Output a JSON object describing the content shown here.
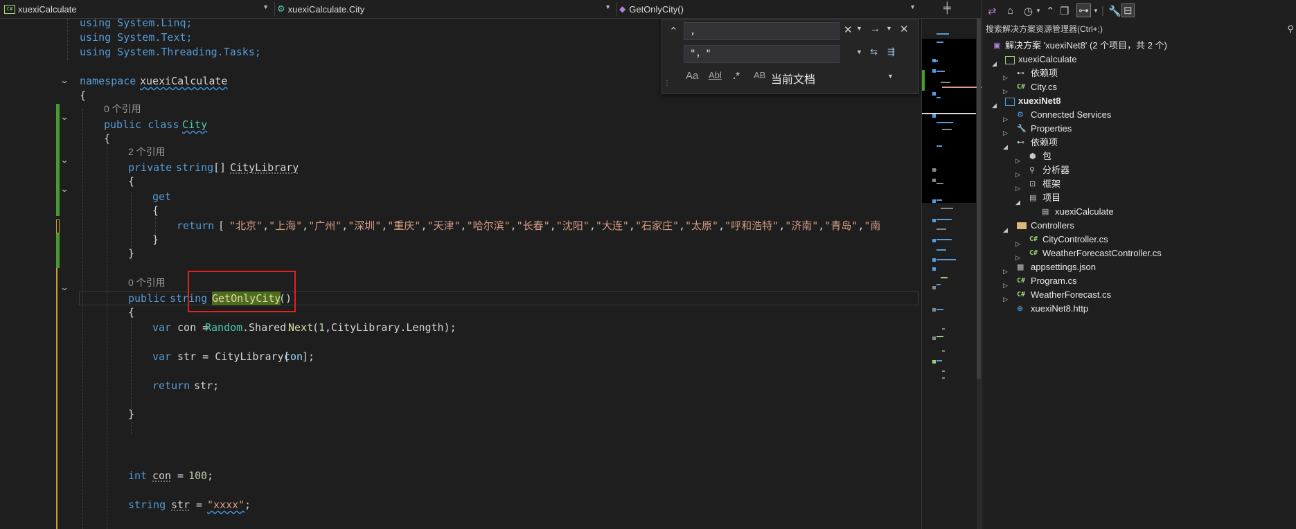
{
  "navbar": {
    "project": "xuexiCalculate",
    "class": "xuexiCalculate.City",
    "member": "GetOnlyCity()"
  },
  "code": {
    "using_linq": "using System.Linq;",
    "using_text": "using System.Text;",
    "using_tasks": "using System.Threading.Tasks;",
    "ns_kw": "namespace",
    "ns_name": "xuexiCalculate",
    "brace_open": "{",
    "brace_close": "}",
    "refs0": "0 个引用",
    "refs2": "2 个引用",
    "class_mods": "public class",
    "class_name": "City",
    "prop_mods": "private",
    "prop_type": "string",
    "prop_arr": "[]",
    "prop_name": "CityLibrary",
    "get_kw": "get",
    "return_kw": "return",
    "return_open": " [",
    "cities": [
      "\"北京\"",
      "\"上海\"",
      "\"广州\"",
      "\"深圳\"",
      "\"重庆\"",
      "\"天津\"",
      "\"哈尔滨\"",
      "\"长春\"",
      "\"沈阳\"",
      "\"大连\"",
      "\"石家庄\"",
      "\"太原\"",
      "\"呼和浩特\"",
      "\"济南\"",
      "\"青岛\"",
      "\"南"
    ],
    "method_mods": "public",
    "method_type": "string",
    "method_name": "GetOnlyCity",
    "method_parens": "()",
    "var_kw": "var",
    "con_decl": " con =",
    "random": "Random",
    "shared": ".Shared.",
    "next": "Next",
    "next_args_open": "(",
    "one": "1",
    "next_args_rest": ",CityLibrary.Length);",
    "str_decl": " str = CityLibrary[",
    "con": "con",
    "str_decl_end": "];",
    "return_str": " str;",
    "int_kw": "int",
    "con_field": "con",
    "eq": " = ",
    "hundred": "100",
    "semi": ";",
    "string_kw": "string",
    "str_field": "str",
    "xxxx": "\"xxxx\""
  },
  "find": {
    "search_value": ",",
    "replace_value": "\"，\"",
    "scope": "当前文档",
    "opt_case": "Aa",
    "opt_word": "Abl",
    "opt_regex": ".*",
    "opt_preserve": "AB"
  },
  "solution_explorer": {
    "search_placeholder": "搜索解决方案资源管理器(Ctrl+;)",
    "items": [
      {
        "label": "解决方案 'xuexiNet8' (2 个项目，共 2 个)",
        "icon": "solution-icon"
      },
      {
        "label": "xuexiCalculate",
        "icon": "csharp-project-icon"
      },
      {
        "label": "依赖项",
        "icon": "dependencies-icon"
      },
      {
        "label": "City.cs",
        "icon": "csharp-file-icon"
      },
      {
        "label": "xuexiNet8",
        "icon": "web-project-icon"
      },
      {
        "label": "Connected Services",
        "icon": "connected-services-icon"
      },
      {
        "label": "Properties",
        "icon": "properties-icon"
      },
      {
        "label": "依赖项",
        "icon": "dependencies-icon"
      },
      {
        "label": "包",
        "icon": "package-icon"
      },
      {
        "label": "分析器",
        "icon": "analyzer-icon"
      },
      {
        "label": "框架",
        "icon": "framework-icon"
      },
      {
        "label": "项目",
        "icon": "project-ref-icon"
      },
      {
        "label": "xuexiCalculate",
        "icon": "project-ref-item-icon"
      },
      {
        "label": "Controllers",
        "icon": "folder-icon"
      },
      {
        "label": "CityController.cs",
        "icon": "csharp-file-icon"
      },
      {
        "label": "WeatherForecastController.cs",
        "icon": "csharp-file-icon"
      },
      {
        "label": "appsettings.json",
        "icon": "json-file-icon"
      },
      {
        "label": "Program.cs",
        "icon": "csharp-file-icon"
      },
      {
        "label": "WeatherForecast.cs",
        "icon": "csharp-file-icon"
      },
      {
        "label": "xuexiNet8.http",
        "icon": "http-file-icon"
      }
    ]
  },
  "colors": {
    "keyword": "#569cd6",
    "type": "#4ec9b0",
    "method": "#dcdcaa",
    "string": "#d69d85",
    "number": "#b5cea8",
    "change_bar": "#4a9a34",
    "highlight": "#4f6b1c",
    "annotation_box": "#e0231c"
  }
}
